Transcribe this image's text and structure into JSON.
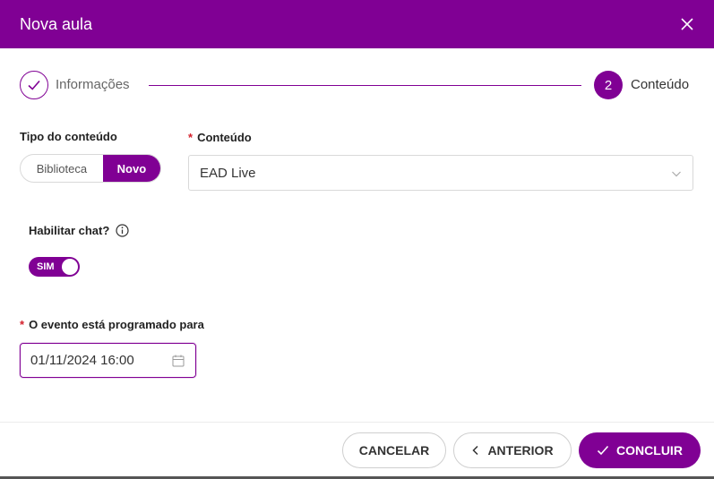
{
  "header": {
    "title": "Nova aula"
  },
  "steps": [
    {
      "label": "Informações",
      "state": "done"
    },
    {
      "number": "2",
      "label": "Conteúdo",
      "state": "active"
    }
  ],
  "tipo": {
    "label": "Tipo do conteúdo",
    "options": [
      "Biblioteca",
      "Novo"
    ],
    "selected": "Novo"
  },
  "conteudo": {
    "required_mark": "*",
    "label": "Conteúdo",
    "value": "EAD Live"
  },
  "chat": {
    "label": "Habilitar chat?",
    "toggle_text": "SIM",
    "enabled": true
  },
  "evento": {
    "required_mark": "*",
    "label": "O evento está programado para",
    "value": "01/11/2024 16:00"
  },
  "footer": {
    "cancel": "CANCELAR",
    "previous": "ANTERIOR",
    "finish": "CONCLUIR"
  },
  "colors": {
    "primary": "#800094",
    "required": "#d4202b"
  }
}
